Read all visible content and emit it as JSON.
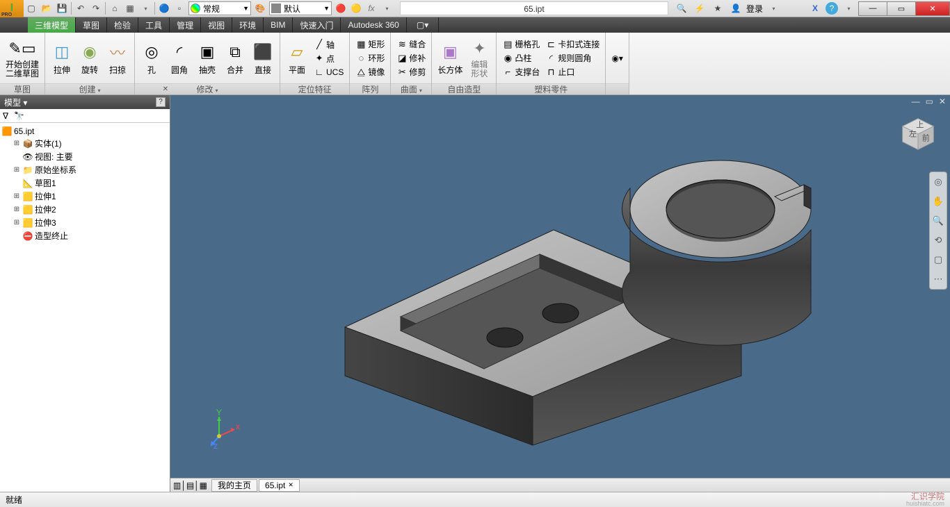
{
  "qat": {
    "style_label": "常规",
    "layer_label": "默认",
    "doc_title": "65.ipt",
    "login": "登录"
  },
  "tabs": [
    "三维模型",
    "草图",
    "检验",
    "工具",
    "管理",
    "视图",
    "环境",
    "BIM",
    "快速入门",
    "Autodesk 360"
  ],
  "active_tab": 0,
  "ribbon": {
    "sketch": {
      "title": "草图",
      "start": "开始创建\n二维草图"
    },
    "create": {
      "title": "创建",
      "extrude": "拉伸",
      "revolve": "旋转",
      "sweep": "扫掠"
    },
    "modify": {
      "title": "修改",
      "hole": "孔",
      "fillet": "圆角",
      "shell": "抽壳",
      "combine": "合并",
      "direct": "直接"
    },
    "workfeat": {
      "title": "定位特征",
      "plane": "平面",
      "axis": "轴",
      "point": "点",
      "ucs": "UCS"
    },
    "pattern": {
      "title": "阵列",
      "rect": "矩形",
      "circ": "环形",
      "mirror": "镜像"
    },
    "surface": {
      "title": "曲面",
      "stitch": "缝合",
      "patch": "修补",
      "trim": "修剪"
    },
    "freeform": {
      "title": "自由造型",
      "box": "长方体",
      "edit": "编辑\n形状"
    },
    "plastic": {
      "title": "塑料零件",
      "grill": "栅格孔",
      "snap": "卡扣式连接",
      "boss": "凸柱",
      "rfillet": "规则圆角",
      "rest": "支撑台",
      "lip": "止口"
    }
  },
  "browser": {
    "title": "模型",
    "root": "65.ipt",
    "nodes": [
      {
        "icon": "📦",
        "label": "实体(1)",
        "exp": "⊞"
      },
      {
        "icon": "👁",
        "label": "视图: 主要",
        "exp": "·"
      },
      {
        "icon": "📁",
        "label": "原始坐标系",
        "exp": "⊞"
      },
      {
        "icon": "📐",
        "label": "草图1",
        "exp": "·"
      },
      {
        "icon": "🟨",
        "label": "拉伸1",
        "exp": "⊞"
      },
      {
        "icon": "🟨",
        "label": "拉伸2",
        "exp": "⊞"
      },
      {
        "icon": "🟨",
        "label": "拉伸3",
        "exp": "⊞"
      },
      {
        "icon": "⛔",
        "label": "造型终止",
        "exp": "·"
      }
    ]
  },
  "doctabs": {
    "home": "我的主页",
    "file": "65.ipt"
  },
  "status": "就绪",
  "watermark": {
    "l1": "汇识学院",
    "l2": "huishiatc.com"
  },
  "viewcube": {
    "left": "左",
    "front": "前",
    "top": "上"
  }
}
